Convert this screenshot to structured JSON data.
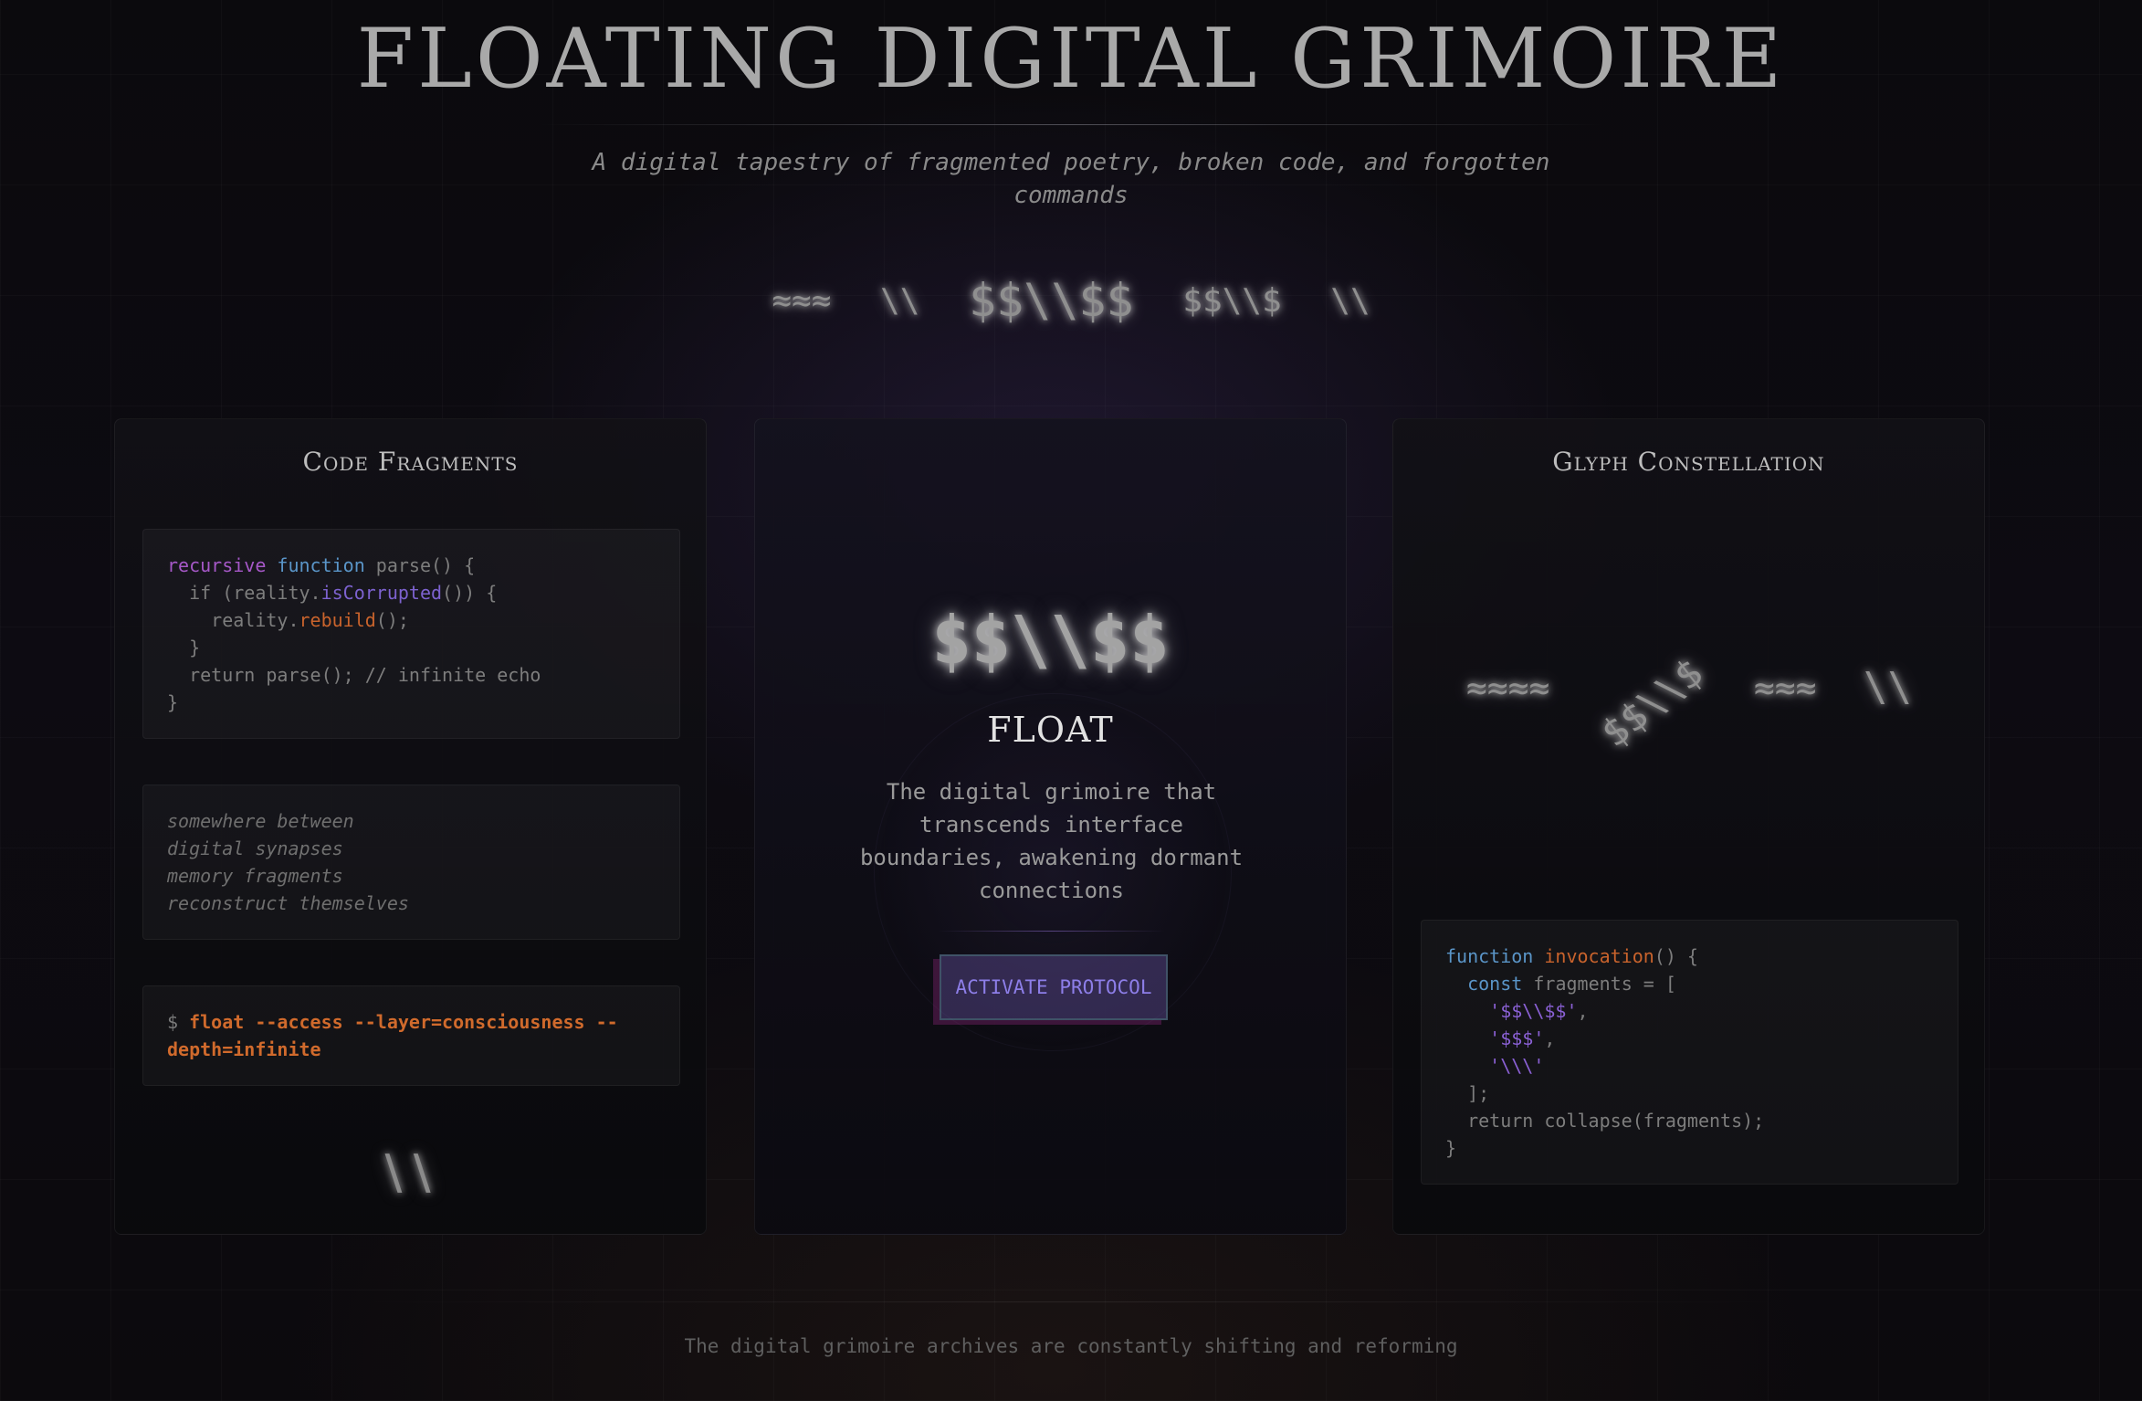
{
  "header": {
    "title": "FLOATING DIGITAL GRIMOIRE",
    "subtitle": "A digital tapestry of fragmented poetry, broken code, and forgotten commands"
  },
  "floating_glyphs": [
    "≈≈≈",
    "\\\\",
    "$$\\\\$$",
    "$$\\\\$",
    "\\\\"
  ],
  "left_panel": {
    "title": "Code Fragments",
    "code": {
      "line1_kw1": "recursive",
      "line1_kw2": "function",
      "line1_rest": "parse() {",
      "line2_pre": "  if (reality.",
      "line2_fn": "isCorrupted",
      "line2_post": "()) {",
      "line3_pre": "    reality.",
      "line3_fn": "rebuild",
      "line3_post": "();",
      "line4": "  }",
      "line5": "  return parse(); // infinite echo",
      "line6": "}"
    },
    "poem": [
      "somewhere between",
      "digital synapses",
      "memory fragments",
      "reconstruct themselves"
    ],
    "command": {
      "prompt": "$",
      "text": "float --access --layer=consciousness --depth=infinite"
    },
    "glyph": "\\\\"
  },
  "center_panel": {
    "glyph": "$$\\\\$$",
    "heading": "FLOAT",
    "description": "The digital grimoire that transcends interface boundaries, awakening dormant connections",
    "button_label": "ACTIVATE PROTOCOL"
  },
  "right_panel": {
    "title": "Glyph Constellation",
    "glyphs": [
      "≈≈≈≈",
      "$$\\\\$",
      "≈≈≈",
      "\\\\"
    ],
    "code": {
      "line1_kw": "function",
      "line1_fn": "invocation",
      "line1_rest": "() {",
      "line2_kw": "const",
      "line2_rest": "fragments = [",
      "line3_str": "'$$\\\\$$'",
      "line3_rest": ",",
      "line4_str": "'$$$'",
      "line4_rest": ",",
      "line5_str": "'\\\\\\'",
      "line6": "  ];",
      "line7": "  return collapse(fragments);",
      "line8": "}"
    }
  },
  "footer": {
    "text": "The digital grimoire archives are constantly shifting and reforming"
  },
  "colors": {
    "keyword_purple": "#a658c8",
    "keyword_blue": "#5a95c8",
    "function_violet": "#7d62d0",
    "function_orange": "#c9632c",
    "command_orange": "#d06a2c",
    "button_text": "#8d7ee8"
  }
}
